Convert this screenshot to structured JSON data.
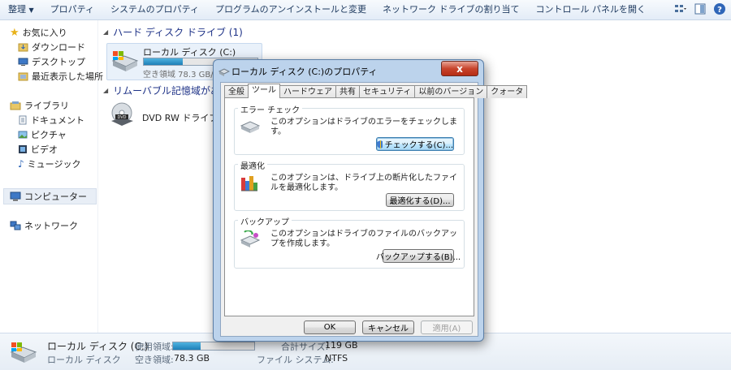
{
  "toolbar": {
    "organize": "整理",
    "items": [
      "プロパティ",
      "システムのプロパティ",
      "プログラムのアンインストールと変更",
      "ネットワーク ドライブの割り当て",
      "コントロール パネルを開く"
    ]
  },
  "sidebar": {
    "favorites": "お気に入り",
    "downloads": "ダウンロード",
    "desktop": "デスクトップ",
    "recent": "最近表示した場所",
    "libraries": "ライブラリ",
    "documents": "ドキュメント",
    "pictures": "ピクチャ",
    "videos": "ビデオ",
    "music": "ミュージック",
    "computer": "コンピューター",
    "network": "ネットワーク"
  },
  "main": {
    "hdd_group": "ハード ディスク ドライブ (1)",
    "removable_group": "リムーバブル記憶域があ",
    "local_disk": {
      "name": "ローカル ディスク (C:)",
      "free": "空き領域 78.3 GB/11",
      "used_fraction": 0.34
    },
    "dvd": {
      "name": "DVD RW ドライブ (E"
    }
  },
  "status": {
    "name": "ローカル ディスク (C:)",
    "type": "ローカル ディスク",
    "used_label": "使用領域:",
    "free_label": "空き領域:",
    "free_value": "78.3 GB",
    "total_label": "合計サイズ:",
    "total_value": "119 GB",
    "fs_label": "ファイル システム:",
    "fs_value": "NTFS",
    "used_fraction": 0.34
  },
  "dialog": {
    "title": "ローカル ディスク (C:)のプロパティ",
    "close": "x",
    "tabs": [
      "全般",
      "ツール",
      "ハードウェア",
      "共有",
      "セキュリティ",
      "以前のバージョン",
      "クォータ"
    ],
    "active_tab": "ツール",
    "error_check": {
      "label": "エラー チェック",
      "text": "このオプションはドライブのエラーをチェックします。",
      "button": "チェックする(C)..."
    },
    "optimize": {
      "label": "最適化",
      "text": "このオプションは、ドライブ上の断片化したファイルを最適化します。",
      "button": "最適化する(D)..."
    },
    "backup": {
      "label": "バックアップ",
      "text": "このオプションはドライブのファイルのバックアップを作成します。",
      "button": "バックアップする(B)..."
    },
    "ok": "OK",
    "cancel": "キャンセル",
    "apply": "適用(A)"
  }
}
